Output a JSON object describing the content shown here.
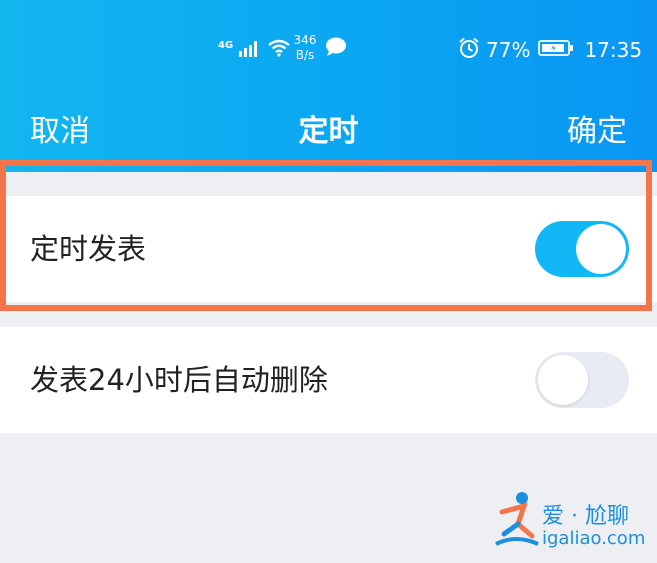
{
  "status_bar": {
    "network_type": "4G",
    "net_speed_value": "346",
    "net_speed_unit": "B/s",
    "battery_percent": "77%",
    "time": "17:35",
    "icons": [
      "signal-icon",
      "wifi-icon",
      "message-bubble-icon",
      "alarm-icon",
      "battery-icon"
    ]
  },
  "nav": {
    "cancel_label": "取消",
    "title": "定时",
    "confirm_label": "确定"
  },
  "settings": [
    {
      "label": "定时发表",
      "toggle_on": true
    },
    {
      "label": "发表24小时后自动删除",
      "toggle_on": false
    }
  ],
  "watermark": {
    "title": "爱 · 尬聊",
    "url": "igaliao.com"
  },
  "colors": {
    "header_gradient_start": "#12b6ef",
    "header_gradient_end": "#0996f3",
    "toggle_on": "#12b7f5",
    "toggle_off": "#e9ebf2",
    "highlight_border": "#f5744a",
    "page_background": "#eeeff3"
  }
}
